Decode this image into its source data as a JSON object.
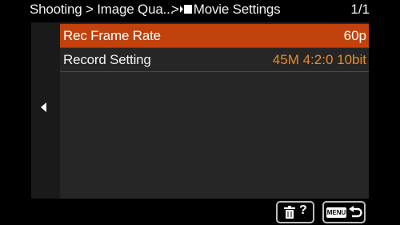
{
  "header": {
    "breadcrumb_1": "Shooting > Image Qua...",
    "breadcrumb_2": ">",
    "breadcrumb_title": "Movie Settings",
    "page_indicator": "1/1"
  },
  "menu": {
    "items": [
      {
        "label": "Rec Frame Rate",
        "value": "60p",
        "selected": true
      },
      {
        "label": "Record Setting",
        "value": "45M 4:2:0 10bit",
        "selected": false
      }
    ]
  },
  "footer": {
    "help_symbol": "?",
    "menu_text": "MENU"
  },
  "colors": {
    "highlight": "#c2420d",
    "value_orange": "#ee8a22",
    "panel": "#262626",
    "background": "#000000"
  },
  "icons": [
    "movie-mode-icon",
    "left-arrow-icon",
    "trash-icon",
    "return-arrow-icon"
  ]
}
